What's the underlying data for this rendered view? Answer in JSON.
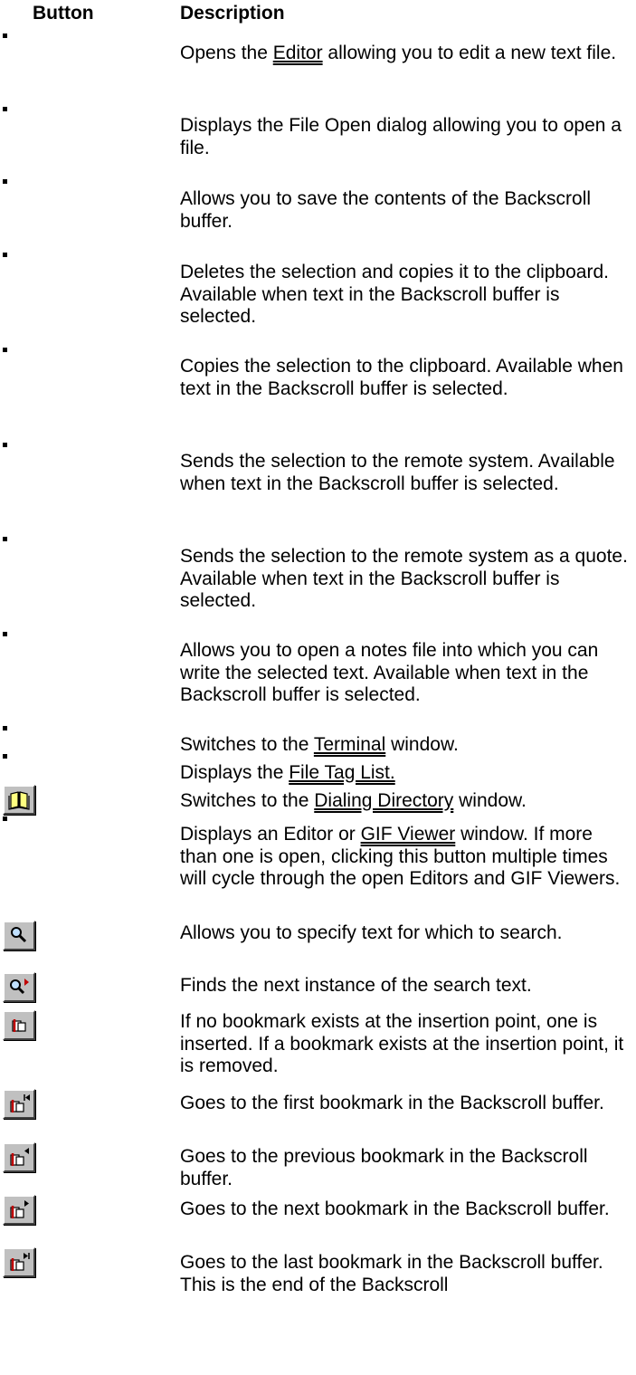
{
  "header": {
    "button": "Button",
    "description": "Description"
  },
  "rows": [
    {
      "parts": [
        "Opens the ",
        "Editor",
        " allowing you to edit a new text file."
      ]
    },
    {
      "text": "Displays the File Open dialog allowing you to open a file."
    },
    {
      "text": "Allows you to save the contents of the Backscroll buffer."
    },
    {
      "text": "Deletes the selection and copies it to the clipboard. Available when text in the Backscroll buffer is selected."
    },
    {
      "text": "Copies the selection to the clipboard. Available when text in the Backscroll buffer is selected."
    },
    {
      "text": "Sends the selection to the remote system. Available when text in the Backscroll buffer is selected."
    },
    {
      "text": "Sends the selection to the remote system as a quote. Available when text in the Backscroll buffer is selected."
    },
    {
      "text": "Allows you to open a notes file into which you can write the selected text. Available when text in the Backscroll buffer is selected."
    },
    {
      "parts": [
        "Switches to the ",
        "Terminal",
        " window."
      ]
    },
    {
      "parts": [
        "Displays the ",
        "File Tag List.",
        ""
      ]
    },
    {
      "parts": [
        "Switches to the ",
        "Dialing Directory",
        " window."
      ]
    },
    {
      "parts": [
        "Displays an Editor or ",
        "GIF Viewer",
        " window. If more than one is open, clicking this button multiple times will cycle through the open Editors and GIF Viewers."
      ]
    },
    {
      "text": "Allows you to specify text for which to search."
    },
    {
      "text": "Finds the next instance of the search text."
    },
    {
      "text": "If no bookmark exists at the insertion point, one is inserted. If a bookmark exists at the insertion point, it is removed."
    },
    {
      "text": "Goes to the first bookmark in the Backscroll buffer."
    },
    {
      "text": "Goes to the previous bookmark in the Backscroll buffer."
    },
    {
      "text": "Goes to the next bookmark in the Backscroll buffer."
    },
    {
      "text": "Goes to the last bookmark in the Backscroll buffer. This is the end of the Backscroll"
    }
  ],
  "icons": {
    "dialing_directory": "book-icon",
    "search": "magnifier-icon",
    "find_next": "magnifier-next-icon",
    "bookmark_toggle": "bookmark-icon",
    "bookmark_first": "bookmark-first-icon",
    "bookmark_prev": "bookmark-previous-icon",
    "bookmark_next": "bookmark-next-icon",
    "bookmark_last": "bookmark-last-icon"
  }
}
